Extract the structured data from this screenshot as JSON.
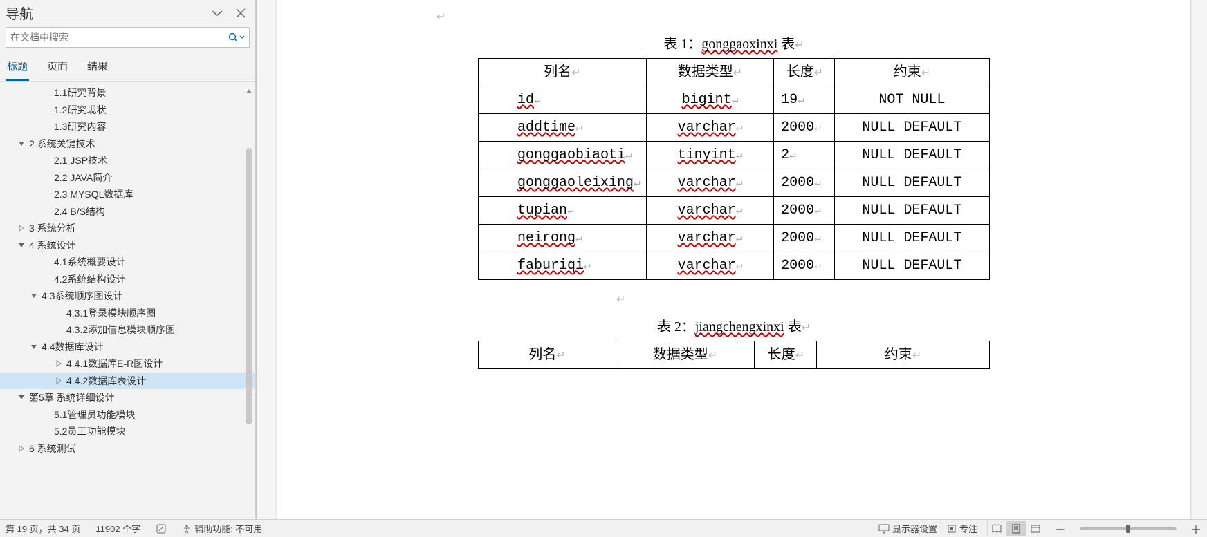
{
  "nav": {
    "title": "导航",
    "search_placeholder": "在文档中搜索",
    "tabs": [
      "标题",
      "页面",
      "结果"
    ],
    "active_tab": 0,
    "outline": [
      {
        "label": "1.1研究背景",
        "level": 3,
        "twist": ""
      },
      {
        "label": "1.2研究现状",
        "level": 3,
        "twist": ""
      },
      {
        "label": "1.3研究内容",
        "level": 3,
        "twist": ""
      },
      {
        "label": "2 系统关键技术",
        "level": 1,
        "twist": "open"
      },
      {
        "label": "2.1 JSP技术",
        "level": 3,
        "twist": ""
      },
      {
        "label": "2.2 JAVA简介",
        "level": 3,
        "twist": ""
      },
      {
        "label": "2.3 MYSQL数据库",
        "level": 3,
        "twist": ""
      },
      {
        "label": "2.4 B/S结构",
        "level": 3,
        "twist": ""
      },
      {
        "label": "3 系统分析",
        "level": 1,
        "twist": "closed"
      },
      {
        "label": "4 系统设计",
        "level": 1,
        "twist": "open"
      },
      {
        "label": "4.1系统概要设计",
        "level": 3,
        "twist": ""
      },
      {
        "label": "4.2系统结构设计",
        "level": 3,
        "twist": ""
      },
      {
        "label": "4.3系统顺序图设计",
        "level": 2,
        "twist": "open"
      },
      {
        "label": "4.3.1登录模块顺序图",
        "level": 4,
        "twist": ""
      },
      {
        "label": "4.3.2添加信息模块顺序图",
        "level": 4,
        "twist": ""
      },
      {
        "label": "4.4数据库设计",
        "level": 2,
        "twist": "open"
      },
      {
        "label": "4.4.1数据库E-R图设计",
        "level": 4,
        "twist": "closed"
      },
      {
        "label": "4.4.2数据库表设计",
        "level": 4,
        "twist": "closed",
        "selected": true
      },
      {
        "label": "第5章 系统详细设计",
        "level": 1,
        "twist": "open"
      },
      {
        "label": "5.1管理员功能模块",
        "level": 3,
        "twist": ""
      },
      {
        "label": "5.2员工功能模块",
        "level": 3,
        "twist": ""
      },
      {
        "label": "6 系统测试",
        "level": 1,
        "twist": "closed"
      }
    ]
  },
  "doc": {
    "table1": {
      "caption_prefix": "表 1：",
      "caption_name": "gonggaoxinxi",
      "caption_suffix": " 表",
      "headers": [
        "列名",
        "数据类型",
        "长度",
        "约束"
      ],
      "rows": [
        {
          "name": "id",
          "type": "bigint",
          "len": "19",
          "cons": "NOT NULL"
        },
        {
          "name": "addtime",
          "type": "varchar",
          "len": "2000",
          "cons": "NULL DEFAULT"
        },
        {
          "name": "gonggaobiaoti",
          "type": "tinyint",
          "len": "2",
          "cons": "NULL DEFAULT"
        },
        {
          "name": "gonggaoleixing",
          "type": "varchar",
          "len": "2000",
          "cons": "NULL DEFAULT"
        },
        {
          "name": "tupian",
          "type": "varchar",
          "len": "2000",
          "cons": "NULL DEFAULT"
        },
        {
          "name": "neirong",
          "type": "varchar",
          "len": "2000",
          "cons": "NULL DEFAULT"
        },
        {
          "name": "faburiqi",
          "type": "varchar",
          "len": "2000",
          "cons": "NULL DEFAULT"
        }
      ]
    },
    "table2": {
      "caption_prefix": "表 2：",
      "caption_name": "jiangchengxinxi",
      "caption_suffix": " 表",
      "headers": [
        "列名",
        "数据类型",
        "长度",
        "约束"
      ]
    }
  },
  "status": {
    "page": "第 19 页，共 34 页",
    "words": "11902 个字",
    "accessibility": "辅助功能: 不可用",
    "display_settings": "显示器设置",
    "focus": "专注"
  }
}
